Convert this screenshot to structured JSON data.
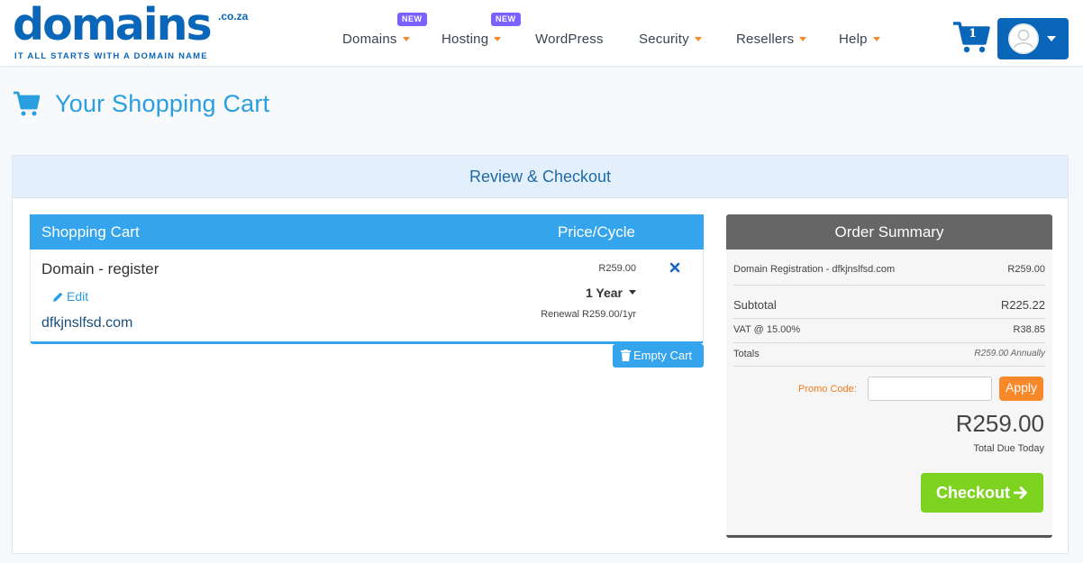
{
  "brand": {
    "name": "domains",
    "tld": ".co.za",
    "tagline": "IT ALL STARTS WITH A DOMAIN NAME",
    "color": "#0a66b8"
  },
  "nav": {
    "items": [
      {
        "label": "Domains",
        "badge": "NEW",
        "dropdown": true
      },
      {
        "label": "Hosting",
        "badge": "NEW",
        "dropdown": true
      },
      {
        "label": "WordPress",
        "dropdown": false
      },
      {
        "label": "Security",
        "dropdown": true
      },
      {
        "label": "Resellers",
        "dropdown": true
      },
      {
        "label": "Help",
        "dropdown": true
      }
    ],
    "cart_count": "1",
    "caret_color": "#f7892b",
    "badge_color": "#7b61ff"
  },
  "page": {
    "title": "Your Shopping Cart",
    "panel_title": "Review & Checkout"
  },
  "cart": {
    "col_item": "Shopping Cart",
    "col_price": "Price/Cycle",
    "item": {
      "type": "Domain - register",
      "edit_label": "Edit",
      "domain": "dfkjnslfsd.com",
      "price": "R259.00",
      "cycle": "1 Year",
      "renewal": "Renewal R259.00/1yr"
    },
    "empty_label": "Empty Cart",
    "accent": "#34a4ec"
  },
  "summary": {
    "title": "Order Summary",
    "line_item_label": "Domain Registration - dfkjnslfsd.com",
    "line_item_value": "R259.00",
    "subtotal_label": "Subtotal",
    "subtotal_value": "R225.22",
    "vat_label": "VAT @ 15.00%",
    "vat_value": "R38.85",
    "totals_label": "Totals",
    "totals_value": "R259.00 Annually",
    "promo_label": "Promo Code:",
    "promo_value": "",
    "apply_label": "Apply",
    "total_due": "R259.00",
    "total_due_label": "Total Due Today",
    "checkout_label": "Checkout",
    "checkout_color": "#7ed321"
  }
}
